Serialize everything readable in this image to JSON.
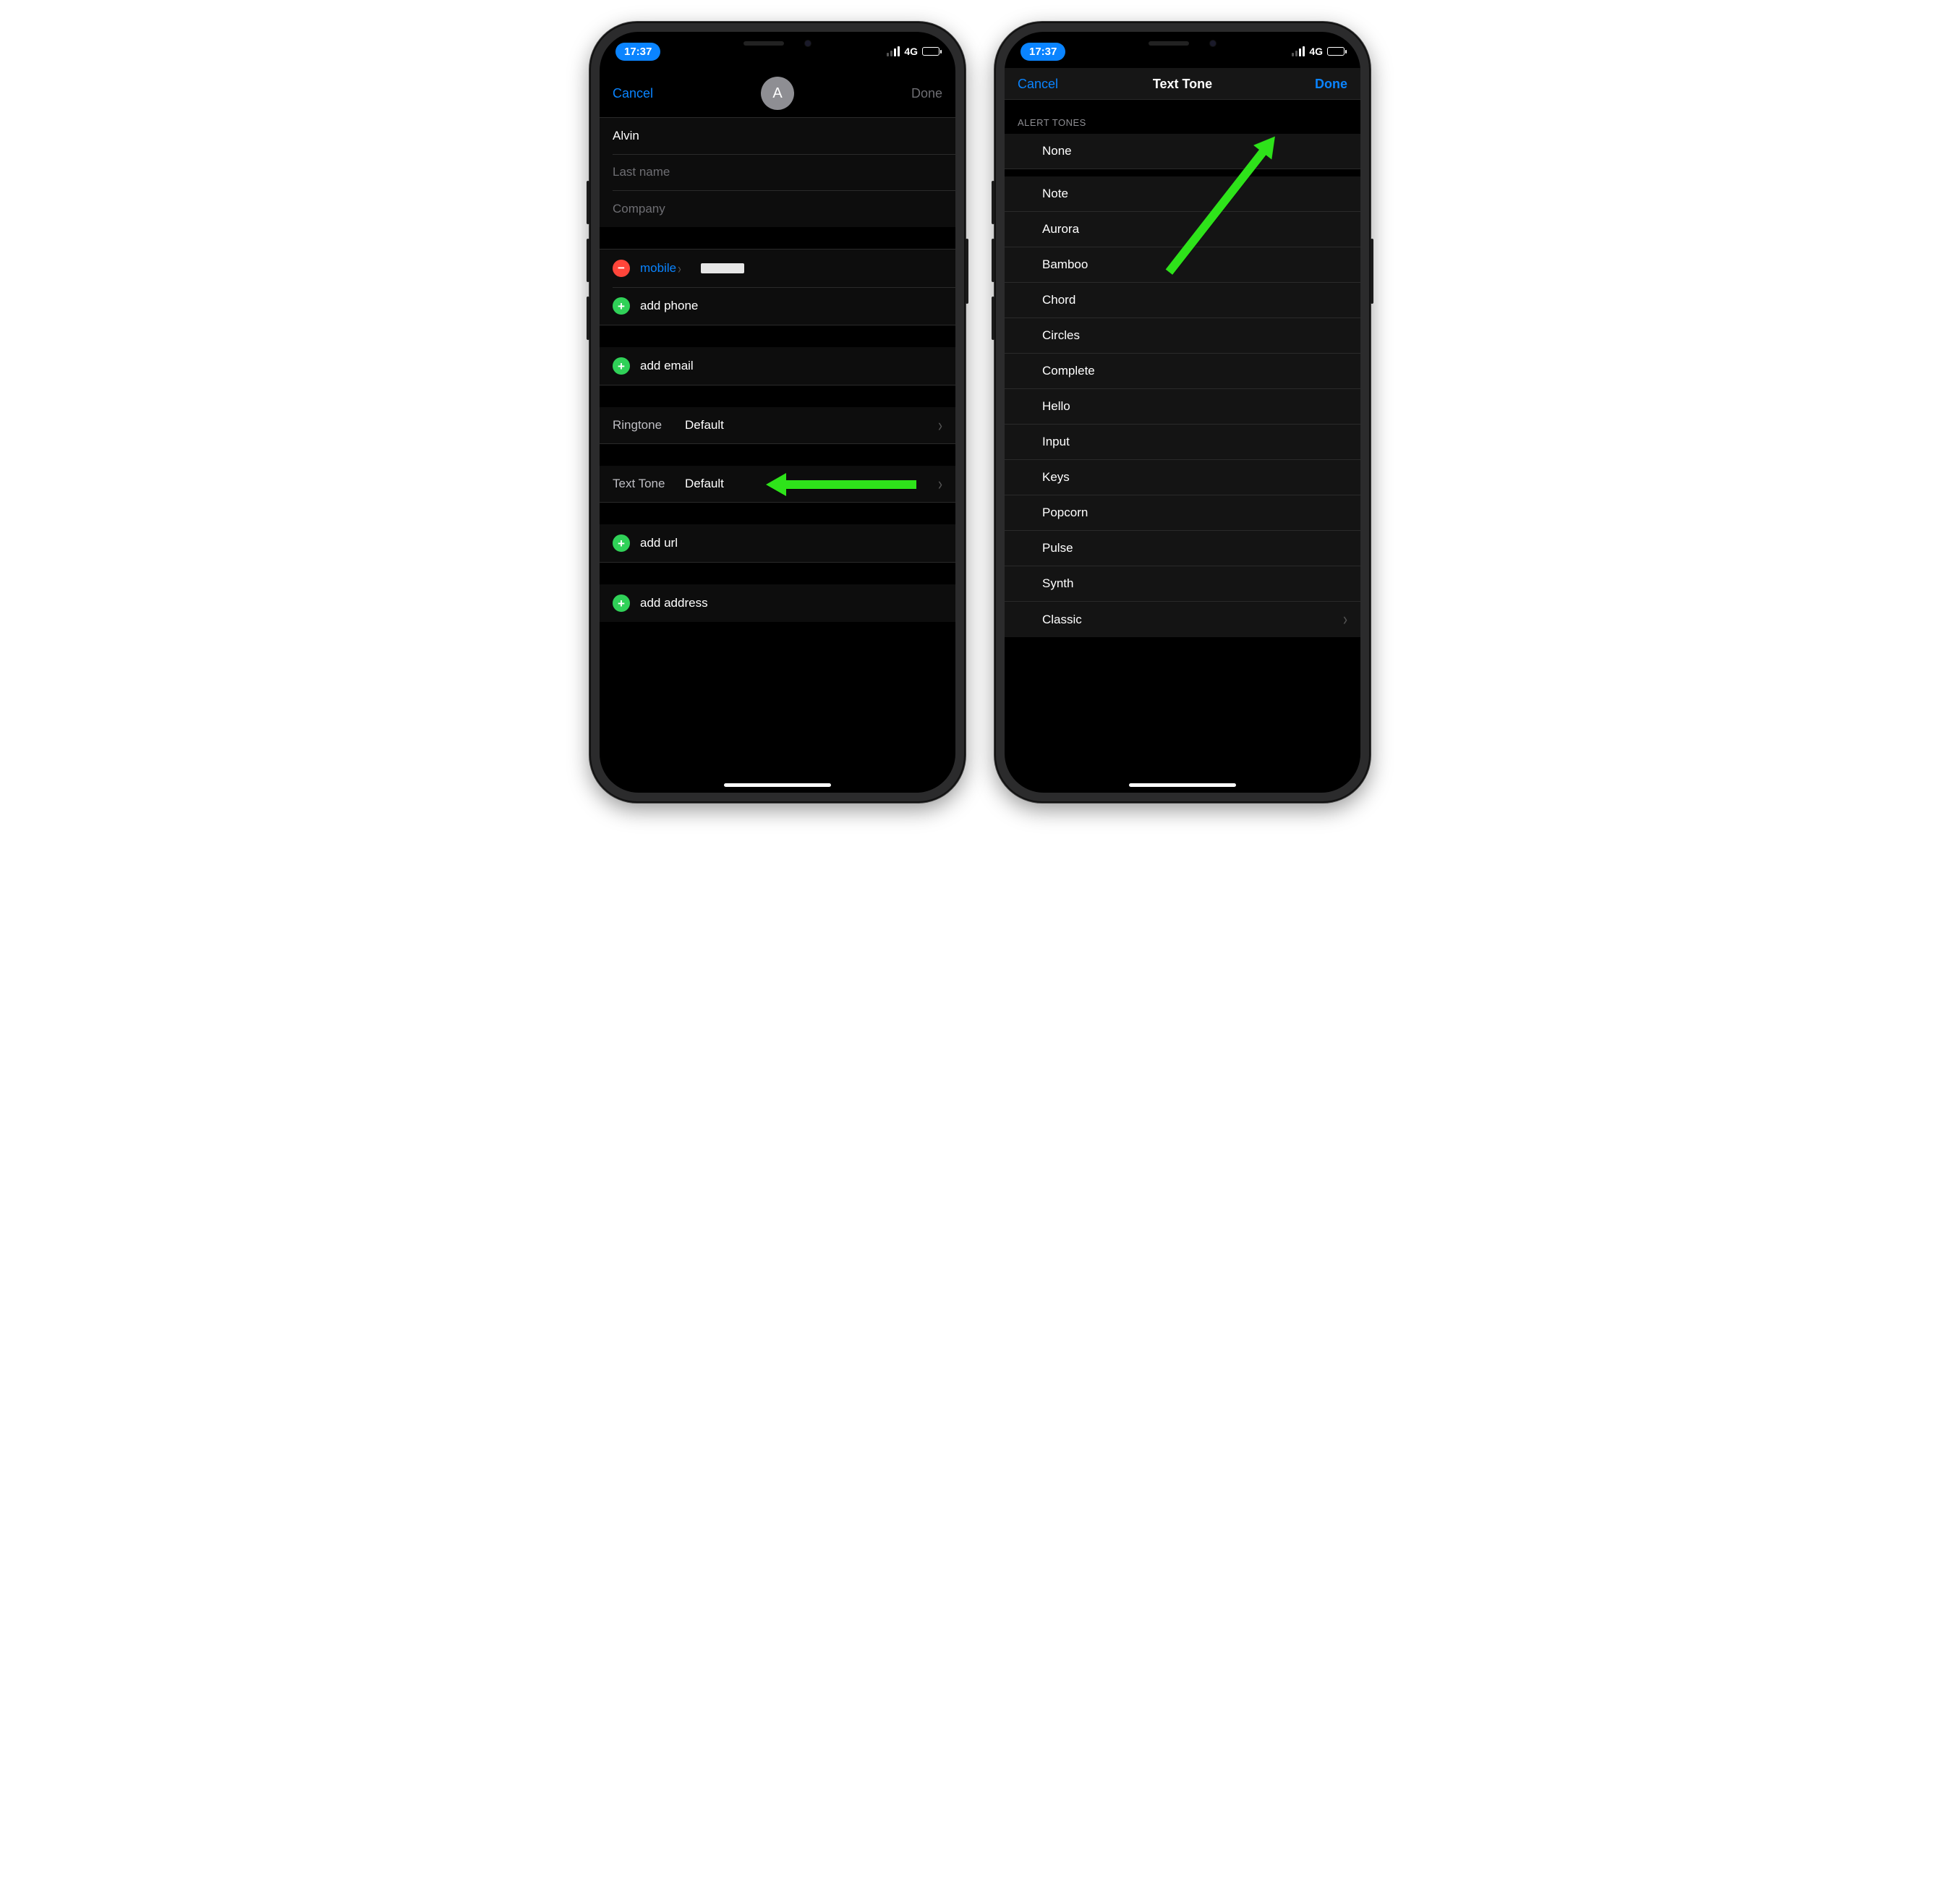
{
  "status": {
    "time": "17:37",
    "network": "4G"
  },
  "left": {
    "nav": {
      "cancel": "Cancel",
      "done": "Done",
      "avatar_initial": "A"
    },
    "fields": {
      "first_name_value": "Alvin",
      "last_name_placeholder": "Last name",
      "company_placeholder": "Company"
    },
    "phone": {
      "type_label": "mobile",
      "add_phone": "add phone"
    },
    "email": {
      "add_email": "add email"
    },
    "ringtone": {
      "label": "Ringtone",
      "value": "Default"
    },
    "texttone": {
      "label": "Text Tone",
      "value": "Default"
    },
    "url": {
      "add_url": "add url"
    },
    "address": {
      "add_address": "add address"
    }
  },
  "right": {
    "nav": {
      "cancel": "Cancel",
      "title": "Text Tone",
      "done": "Done"
    },
    "section_header": "ALERT TONES",
    "tones": [
      "None",
      "Note",
      "Aurora",
      "Bamboo",
      "Chord",
      "Circles",
      "Complete",
      "Hello",
      "Input",
      "Keys",
      "Popcorn",
      "Pulse",
      "Synth",
      "Classic"
    ]
  }
}
